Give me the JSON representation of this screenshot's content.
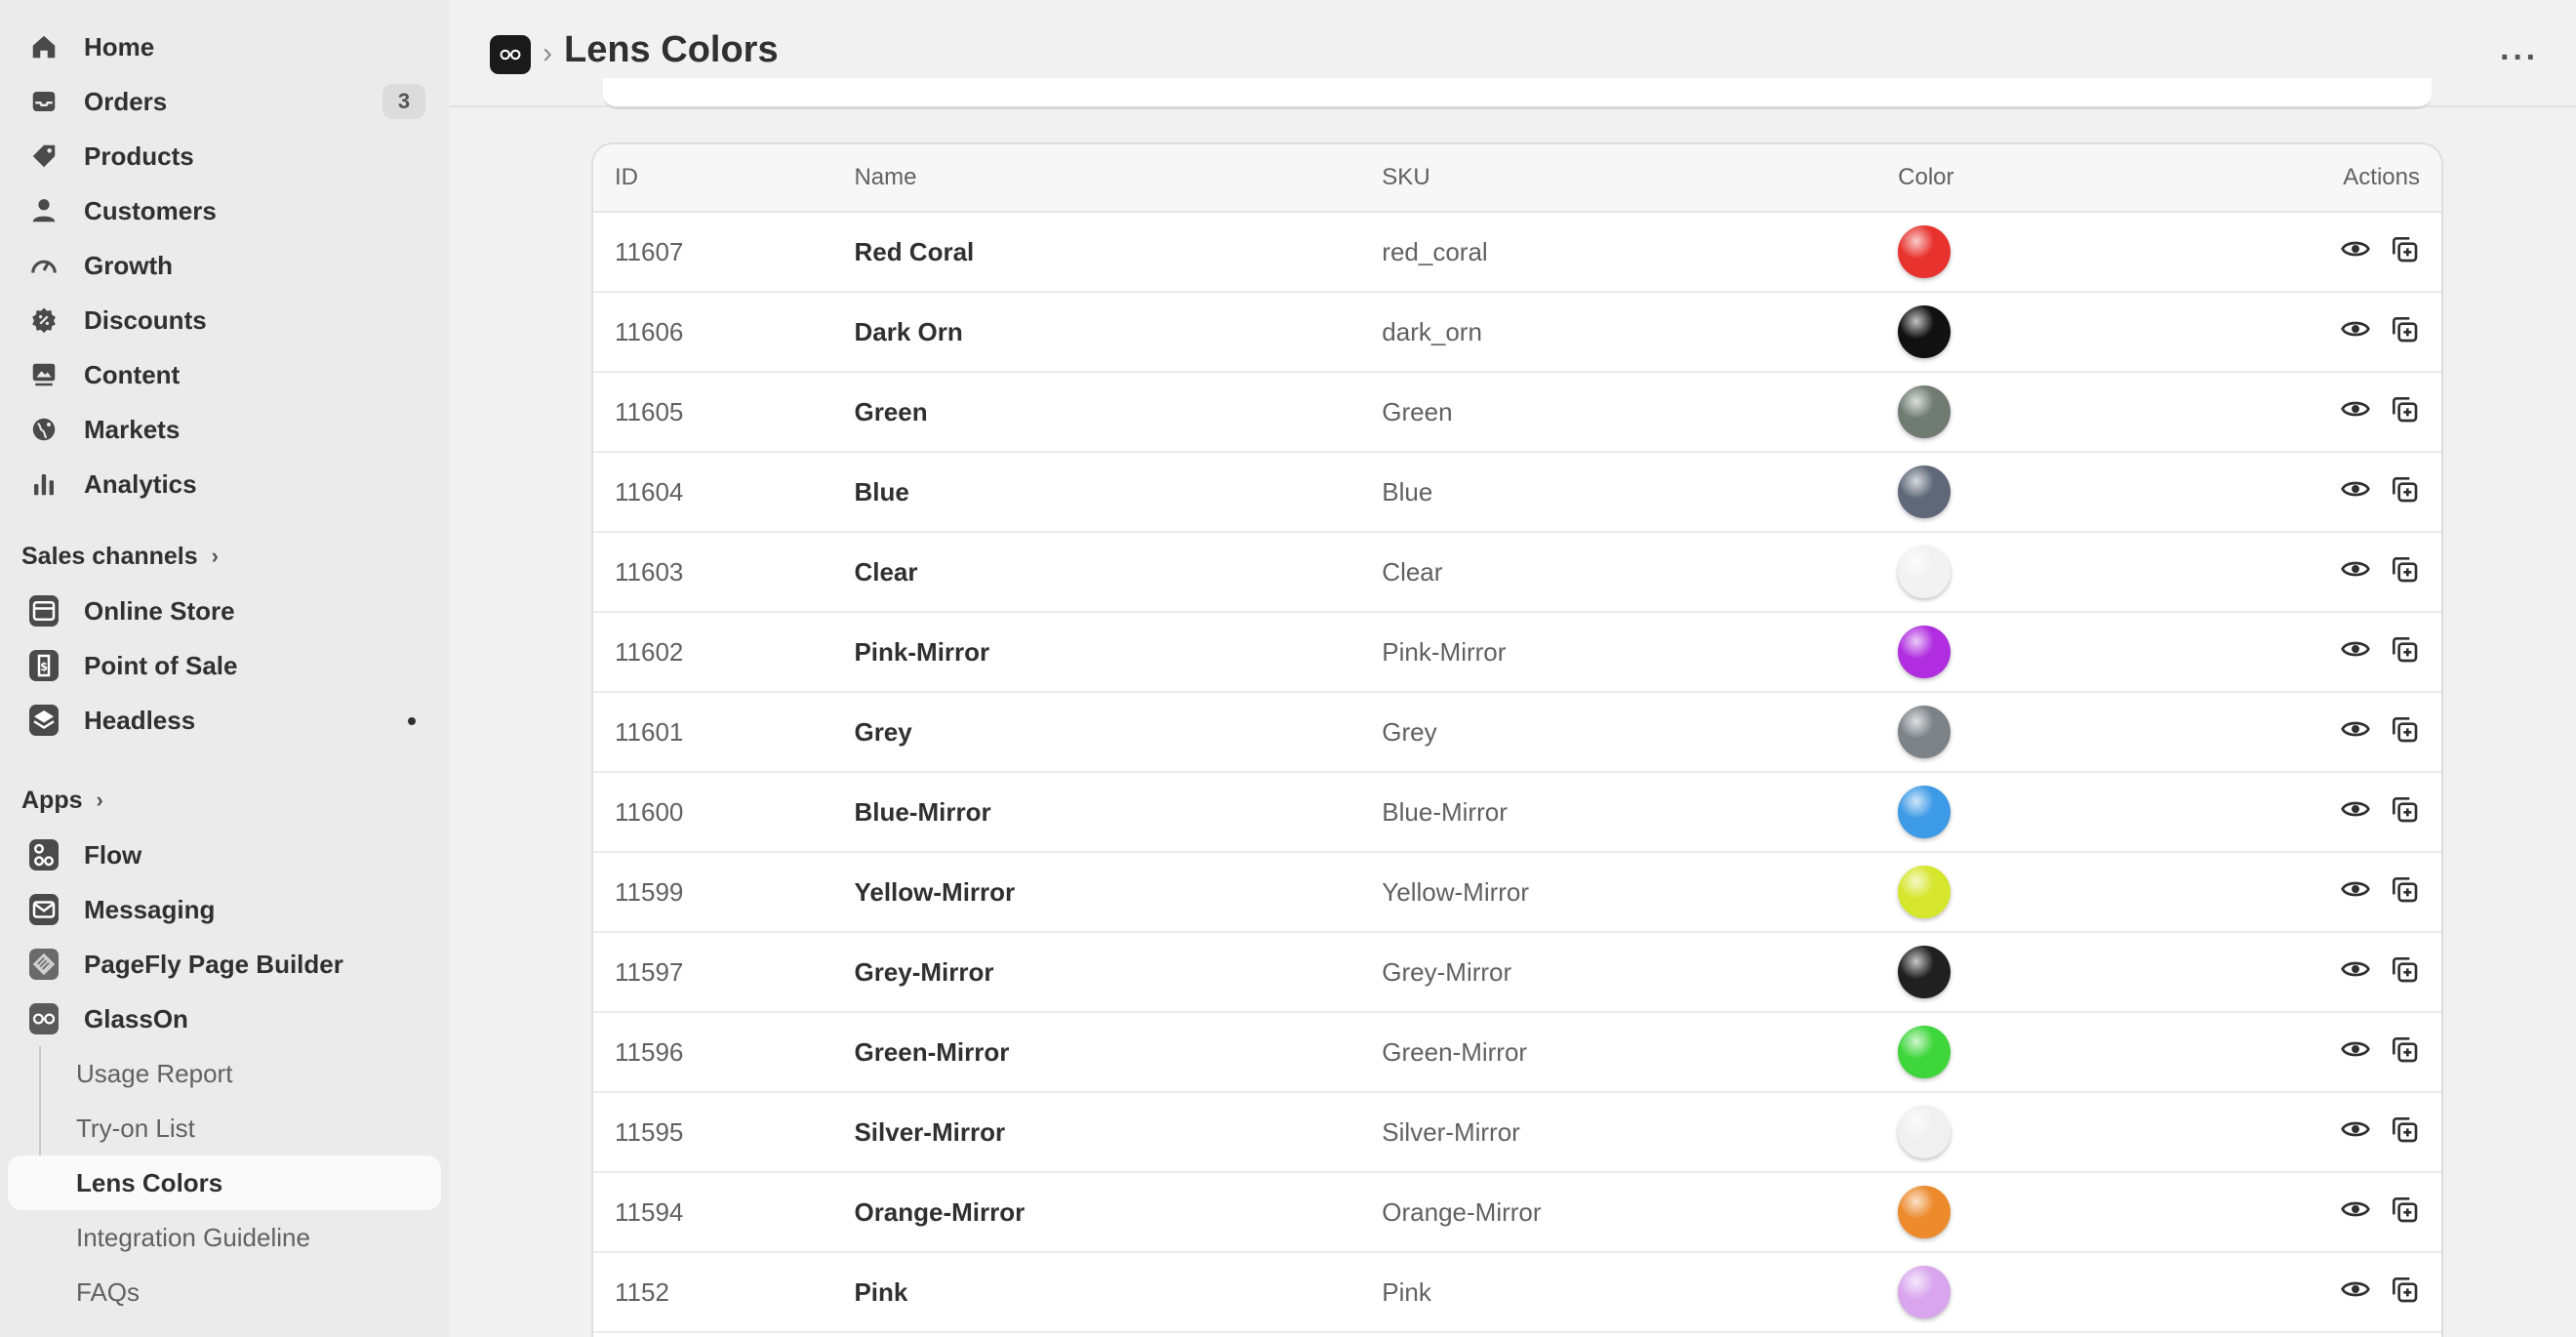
{
  "sidebar": {
    "main": [
      {
        "label": "Home",
        "icon": "home-icon"
      },
      {
        "label": "Orders",
        "icon": "inbox-icon",
        "badge": "3"
      },
      {
        "label": "Products",
        "icon": "tag-icon"
      },
      {
        "label": "Customers",
        "icon": "person-icon"
      },
      {
        "label": "Growth",
        "icon": "gauge-icon"
      },
      {
        "label": "Discounts",
        "icon": "discount-icon"
      },
      {
        "label": "Content",
        "icon": "image-icon"
      },
      {
        "label": "Markets",
        "icon": "globe-icon"
      },
      {
        "label": "Analytics",
        "icon": "bar-chart-icon"
      }
    ],
    "sales_channels_title": "Sales channels",
    "sales_channels": [
      {
        "label": "Online Store"
      },
      {
        "label": "Point of Sale"
      },
      {
        "label": "Headless"
      }
    ],
    "apps_title": "Apps",
    "apps": [
      {
        "label": "Flow"
      },
      {
        "label": "Messaging"
      },
      {
        "label": "PageFly Page Builder"
      },
      {
        "label": "GlassOn"
      }
    ],
    "glasson_sub": [
      {
        "label": "Usage Report"
      },
      {
        "label": "Try-on List"
      },
      {
        "label": "Lens Colors"
      },
      {
        "label": "Integration Guideline"
      },
      {
        "label": "FAQs"
      }
    ]
  },
  "header": {
    "title": "Lens Colors",
    "separator": "›",
    "more": "···"
  },
  "table": {
    "headers": {
      "id": "ID",
      "name": "Name",
      "sku": "SKU",
      "color": "Color",
      "actions": "Actions"
    },
    "rows": [
      {
        "id": "11607",
        "name": "Red Coral",
        "sku": "red_coral",
        "color": "#e8322e"
      },
      {
        "id": "11606",
        "name": "Dark Orn",
        "sku": "dark_orn",
        "color": "#111111"
      },
      {
        "id": "11605",
        "name": "Green",
        "sku": "Green",
        "color": "#6f7b73"
      },
      {
        "id": "11604",
        "name": "Blue",
        "sku": "Blue",
        "color": "#5e6878"
      },
      {
        "id": "11603",
        "name": "Clear",
        "sku": "Clear",
        "color": "#f2f2f2"
      },
      {
        "id": "11602",
        "name": "Pink-Mirror",
        "sku": "Pink-Mirror",
        "color": "#b02ee0"
      },
      {
        "id": "11601",
        "name": "Grey",
        "sku": "Grey",
        "color": "#7b8288"
      },
      {
        "id": "11600",
        "name": "Blue-Mirror",
        "sku": "Blue-Mirror",
        "color": "#3d9ae6"
      },
      {
        "id": "11599",
        "name": "Yellow-Mirror",
        "sku": "Yellow-Mirror",
        "color": "#d6e62c"
      },
      {
        "id": "11597",
        "name": "Grey-Mirror",
        "sku": "Grey-Mirror",
        "color": "#202020"
      },
      {
        "id": "11596",
        "name": "Green-Mirror",
        "sku": "Green-Mirror",
        "color": "#3ed63a"
      },
      {
        "id": "11595",
        "name": "Silver-Mirror",
        "sku": "Silver-Mirror",
        "color": "#f0f0f0"
      },
      {
        "id": "11594",
        "name": "Orange-Mirror",
        "sku": "Orange-Mirror",
        "color": "#ec8a2c"
      },
      {
        "id": "1152",
        "name": "Pink",
        "sku": "Pink",
        "color": "#d9a6ee"
      }
    ]
  }
}
